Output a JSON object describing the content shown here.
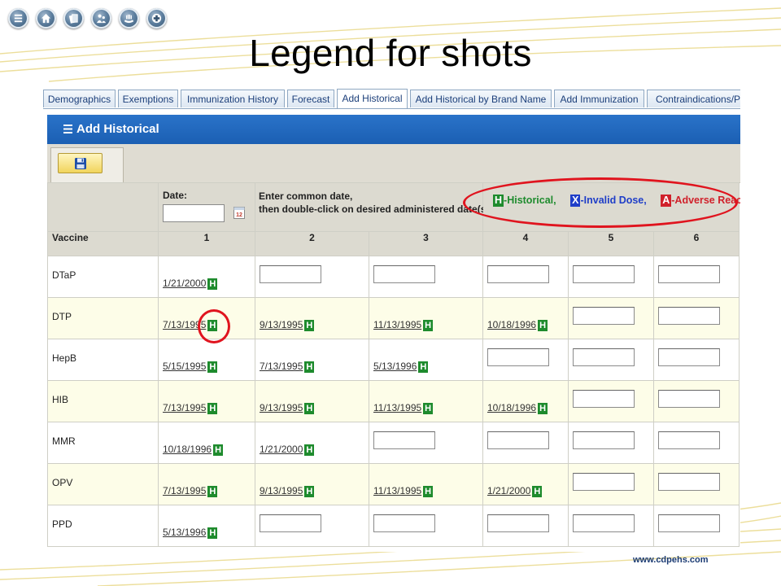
{
  "slide": {
    "title": "Legend for shots",
    "footer_url": "www.cdpehs.com"
  },
  "top_icons": [
    "list-icon",
    "home-icon",
    "documents-icon",
    "family-icon",
    "hands-icon",
    "medical-cross-icon"
  ],
  "tabs": [
    {
      "label": "Demographics"
    },
    {
      "label": "Exemptions"
    },
    {
      "label": "Immunization History"
    },
    {
      "label": "Forecast"
    },
    {
      "label": "Add Historical",
      "active": true
    },
    {
      "label": "Add Historical by Brand Name"
    },
    {
      "label": "Add Immunization"
    },
    {
      "label": "Contraindications/Pr"
    }
  ],
  "panel": {
    "title": "Add Historical"
  },
  "toolbar": {
    "save_icon": "floppy-disk-icon"
  },
  "form": {
    "date_label": "Date:",
    "date_value": "",
    "instruction_line1": "Enter common date,",
    "instruction_line2": "then double-click on desired administered date(s)."
  },
  "legend": {
    "h_code": "H",
    "h_text": "-Historical,",
    "x_code": "X",
    "x_text": "-Invalid Dose,",
    "a_code": "A",
    "a_text": "-Adverse Reaction"
  },
  "grid": {
    "vaccine_header": "Vaccine",
    "dose_headers": [
      "1",
      "2",
      "3",
      "4",
      "5",
      "6"
    ],
    "rows": [
      {
        "vaccine": "DTaP",
        "doses": [
          "1/21/2000",
          "",
          "",
          "",
          "",
          ""
        ]
      },
      {
        "vaccine": "DTP",
        "doses": [
          "7/13/1995",
          "9/13/1995",
          "11/13/1995",
          "10/18/1996",
          "",
          ""
        ]
      },
      {
        "vaccine": "HepB",
        "doses": [
          "5/15/1995",
          "7/13/1995",
          "5/13/1996",
          "",
          "",
          ""
        ]
      },
      {
        "vaccine": "HIB",
        "doses": [
          "7/13/1995",
          "9/13/1995",
          "11/13/1995",
          "10/18/1996",
          "",
          ""
        ]
      },
      {
        "vaccine": "MMR",
        "doses": [
          "10/18/1996",
          "1/21/2000",
          "",
          "",
          "",
          ""
        ]
      },
      {
        "vaccine": "OPV",
        "doses": [
          "7/13/1995",
          "9/13/1995",
          "11/13/1995",
          "1/21/2000",
          "",
          ""
        ]
      },
      {
        "vaccine": "PPD",
        "doses": [
          "5/13/1996",
          "",
          "",
          "",
          "",
          ""
        ]
      }
    ],
    "historical_badge": "H"
  },
  "colors": {
    "historical": "#1e8b2d",
    "invalid": "#1f3ec8",
    "adverse": "#d0202a",
    "panel_header": "#1b5fb3",
    "annotation_ring": "#e0141e"
  }
}
